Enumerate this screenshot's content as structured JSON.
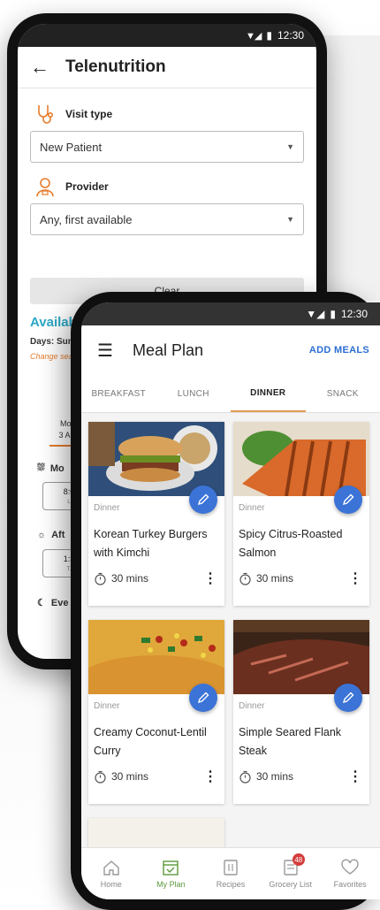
{
  "back_phone": {
    "status": {
      "time": "12:30"
    },
    "appbar": {
      "title": "Telenutrition"
    },
    "visit_type": {
      "label": "Visit type",
      "value": "New Patient"
    },
    "provider": {
      "label": "Provider",
      "value": "Any, first available"
    },
    "clear_label": "Clear",
    "available_title": "Availabl",
    "days_text": "Days: Sun -",
    "change_search": "Change sea",
    "day_column": {
      "weekday": "Mon,",
      "date": "3 Aug"
    },
    "time_of_day": [
      {
        "label": "Mo",
        "slot": "8:0",
        "slot_sub": "L"
      },
      {
        "label": "Aft",
        "slot": "1:3",
        "slot_sub": "T."
      },
      {
        "label": "Eve"
      }
    ]
  },
  "front_phone": {
    "status": {
      "time": "12:30"
    },
    "appbar": {
      "title": "Meal Plan",
      "action": "ADD MEALS"
    },
    "tabs": [
      {
        "label": "BREAKFAST",
        "active": false
      },
      {
        "label": "LUNCH",
        "active": false
      },
      {
        "label": "DINNER",
        "active": true
      },
      {
        "label": "SNACK",
        "active": false
      }
    ],
    "meals": [
      {
        "tag": "Dinner",
        "name": "Korean Turkey Burgers with Kimchi",
        "time": "30 mins"
      },
      {
        "tag": "Dinner",
        "name": "Spicy Citrus-Roasted Salmon",
        "time": "30 mins"
      },
      {
        "tag": "Dinner",
        "name": "Creamy Coconut-Lentil Curry",
        "time": "30 mins"
      },
      {
        "tag": "Dinner",
        "name": "Simple Seared Flank Steak",
        "time": "30 mins"
      }
    ],
    "bottom_nav": [
      {
        "label": "Home",
        "icon": "home-icon"
      },
      {
        "label": "My Plan",
        "icon": "calendar-check-icon",
        "active": true
      },
      {
        "label": "Recipes",
        "icon": "recipes-icon"
      },
      {
        "label": "Grocery List",
        "icon": "grocery-list-icon",
        "badge": "48"
      },
      {
        "label": "Favorites",
        "icon": "heart-icon"
      }
    ]
  },
  "colors": {
    "accent_blue": "#3b73d6",
    "accent_orange": "#e09a52",
    "teal": "#2aa7c4",
    "nav_active": "#5a9a3c",
    "badge": "#d43c3c"
  }
}
